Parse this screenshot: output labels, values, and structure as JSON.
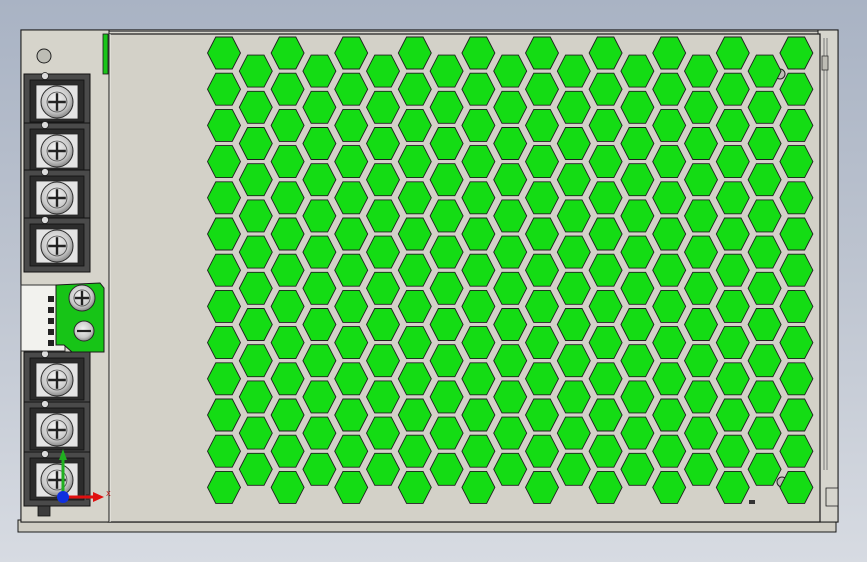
{
  "app": {
    "view": "CAD 3D viewport",
    "model": "power-supply-unit"
  },
  "colors": {
    "background_top": "#a9b3c4",
    "background_bottom": "#d7dbe2",
    "housing": "#d2d0c7",
    "housing_edge": "#1a1a1a",
    "vent_hole": "#14dc14",
    "terminal_block": "#3a3a3a",
    "pcb": "#17c417",
    "axis_x": "#e01010",
    "axis_y": "#20b020",
    "axis_z": "#1030e0"
  },
  "terminal_block": {
    "screw_terminal_count": 7,
    "adjust_pot_count": 1
  },
  "vent_grid": {
    "rows": 13,
    "columns": 19,
    "shape": "hexagon"
  },
  "triad": {
    "axes": [
      "X",
      "Y",
      "Z"
    ],
    "x_label": "X"
  }
}
